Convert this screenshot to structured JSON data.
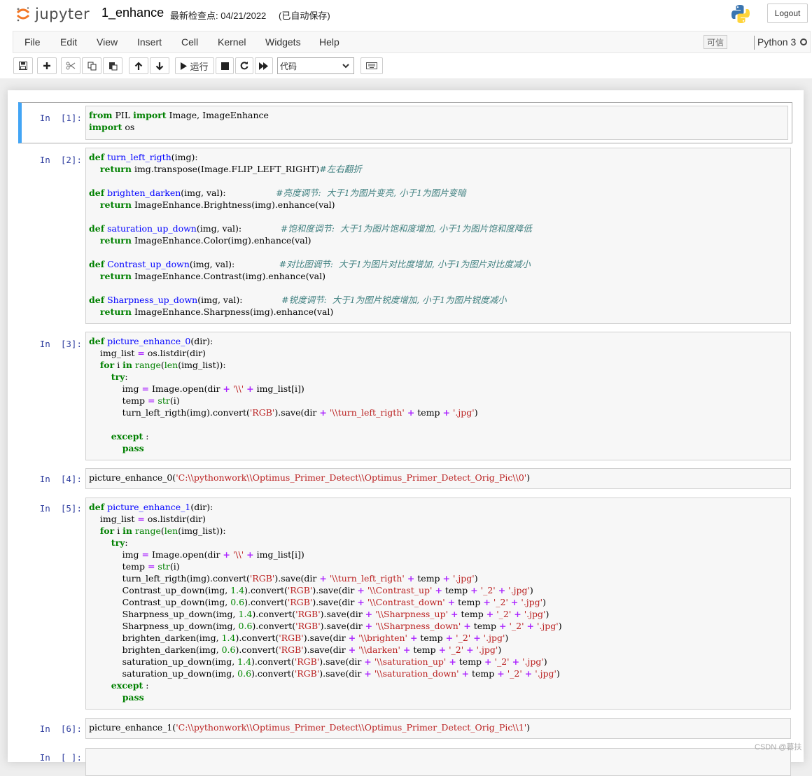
{
  "header": {
    "logo_text": "jupyter",
    "notebook_title": "1_enhance",
    "checkpoint": "最新检查点: 04/21/2022",
    "autosave": "(已自动保存)",
    "logout_label": "Logout"
  },
  "menubar": {
    "items": [
      "File",
      "Edit",
      "View",
      "Insert",
      "Cell",
      "Kernel",
      "Widgets",
      "Help"
    ],
    "trusted_label": "可信",
    "kernel_name": "Python 3"
  },
  "toolbar": {
    "run_label": "运行",
    "cell_type": "代码"
  },
  "cells": [
    {
      "prompt": "In  [1]:",
      "code": "from PIL import Image, ImageEnhance\nimport os"
    },
    {
      "prompt": "In  [2]:",
      "code": "def turn_left_rigth(img):\n    return img.transpose(Image.FLIP_LEFT_RIGHT)#左右翻折\n\ndef brighten_darken(img, val):                  #亮度调节:  大于1为图片变亮, 小于1为图片变暗\n    return ImageEnhance.Brightness(img).enhance(val)\n\ndef saturation_up_down(img, val):              #饱和度调节:  大于1为图片饱和度增加, 小于1为图片饱和度降低\n    return ImageEnhance.Color(img).enhance(val)\n\ndef Contrast_up_down(img, val):                #对比图调节:  大于1为图片对比度增加, 小于1为图片对比度减小\n    return ImageEnhance.Contrast(img).enhance(val)\n\ndef Sharpness_up_down(img, val):              #锐度调节:  大于1为图片锐度增加, 小于1为图片锐度减小\n    return ImageEnhance.Sharpness(img).enhance(val)"
    },
    {
      "prompt": "In  [3]:",
      "code": "def picture_enhance_0(dir):\n    img_list = os.listdir(dir)\n    for i in range(len(img_list)):\n        try:\n            img = Image.open(dir + '\\\\' + img_list[i])\n            temp = str(i)\n            turn_left_rigth(img).convert('RGB').save(dir + '\\\\turn_left_rigth' + temp + '.jpg')\n\n        except :\n            pass"
    },
    {
      "prompt": "In  [4]:",
      "code": "picture_enhance_0('C:\\\\pythonwork\\\\Optimus_Primer_Detect\\\\Optimus_Primer_Detect_Orig_Pic\\\\0')"
    },
    {
      "prompt": "In  [5]:",
      "code": "def picture_enhance_1(dir):\n    img_list = os.listdir(dir)\n    for i in range(len(img_list)):\n        try:\n            img = Image.open(dir + '\\\\' + img_list[i])\n            temp = str(i)\n            turn_left_rigth(img).convert('RGB').save(dir + '\\\\turn_left_rigth' + temp + '.jpg')\n            Contrast_up_down(img, 1.4).convert('RGB').save(dir + '\\\\Contrast_up' + temp + '_2' + '.jpg')\n            Contrast_up_down(img, 0.6).convert('RGB').save(dir + '\\\\Contrast_down' + temp + '_2' + '.jpg')\n            Sharpness_up_down(img, 1.4).convert('RGB').save(dir + '\\\\Sharpness_up' + temp + '_2' + '.jpg')\n            Sharpness_up_down(img, 0.6).convert('RGB').save(dir + '\\\\Sharpness_down' + temp + '_2' + '.jpg')\n            brighten_darken(img, 1.4).convert('RGB').save(dir + '\\\\brighten' + temp + '_2' + '.jpg')\n            brighten_darken(img, 0.6).convert('RGB').save(dir + '\\\\darken' + temp + '_2' + '.jpg')\n            saturation_up_down(img, 1.4).convert('RGB').save(dir + '\\\\saturation_up' + temp + '_2' + '.jpg')\n            saturation_up_down(img, 0.6).convert('RGB').save(dir + '\\\\saturation_down' + temp + '_2' + '.jpg')\n        except :\n            pass"
    },
    {
      "prompt": "In  [6]:",
      "code": "picture_enhance_1('C:\\\\pythonwork\\\\Optimus_Primer_Detect\\\\Optimus_Primer_Detect_Orig_Pic\\\\1')"
    },
    {
      "prompt": "In  [ ]:",
      "code": ""
    }
  ],
  "watermark": "CSDN @暮扶",
  "colors": {
    "accent_selected": "#42a5f5",
    "prompt": "#303f9f",
    "keyword": "#008000",
    "function_name": "#0000ff",
    "string": "#ba2121",
    "comment": "#408080",
    "operator": "#aa22ff",
    "logo_orange": "#f37726"
  }
}
